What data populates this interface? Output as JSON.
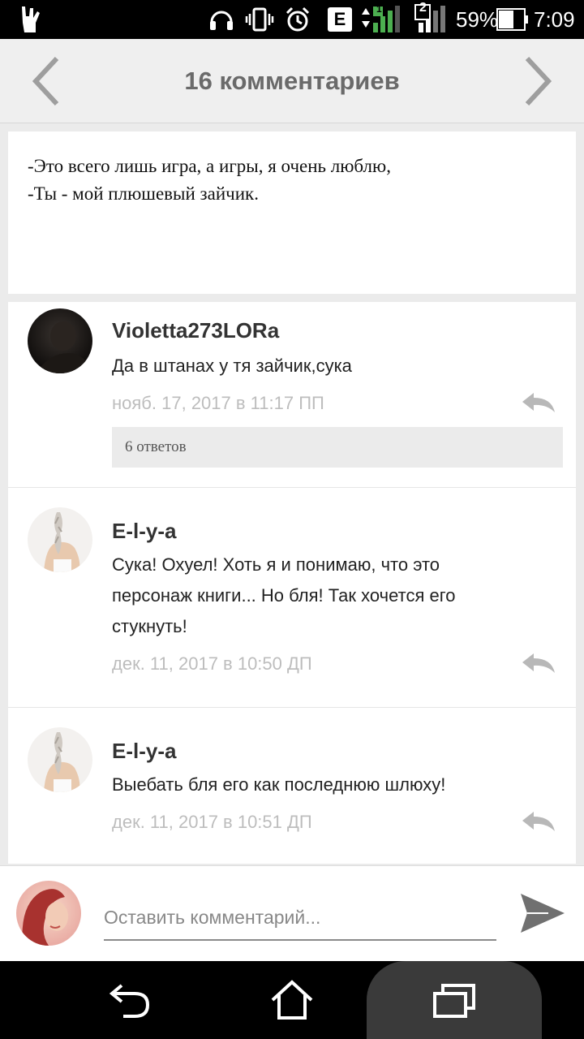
{
  "status_bar": {
    "network_type": "E",
    "sim_badge_1": "1",
    "sim_badge_2": "2",
    "battery": "59%",
    "time": "7:09",
    "icons": [
      "rock-hand-icon",
      "headphones-icon",
      "vibrate-icon",
      "alarm-icon",
      "signal-icon",
      "battery-icon"
    ]
  },
  "header": {
    "title": "16 комментариев",
    "prev_icon": "chevron-left-icon",
    "next_icon": "chevron-right-icon"
  },
  "quote": {
    "lines": [
      "-Это всего лишь игра, а игры, я очень люблю,",
      "-Ты - мой плюшевый зайчик."
    ]
  },
  "comments": [
    {
      "author": "Violetta273LORa",
      "text": "Да в штанах у тя зайчик,сука",
      "date": "нояб. 17, 2017 в 11:17 ПП",
      "replies": "6 ответов"
    },
    {
      "author": "E-l-y-a",
      "text_lines": [
        "Сука! Охуел! Хоть я и понимаю, что это",
        "персонаж книги... Но бля! Так хочется его",
        "стукнуть!"
      ],
      "date": "дек. 11, 2017 в 10:50 ДП"
    },
    {
      "author": "E-l-y-a",
      "text": "Выебать бля его как последнюю шлюху!",
      "date": "дек. 11, 2017 в 10:51 ДП"
    }
  ],
  "input": {
    "placeholder": "Оставить комментарий...",
    "value": ""
  },
  "colors": {
    "status_bar": "#000000",
    "header_bg": "#efefef",
    "title": "#6a6a6a",
    "date": "#bdbdbd",
    "send": "#707070"
  }
}
